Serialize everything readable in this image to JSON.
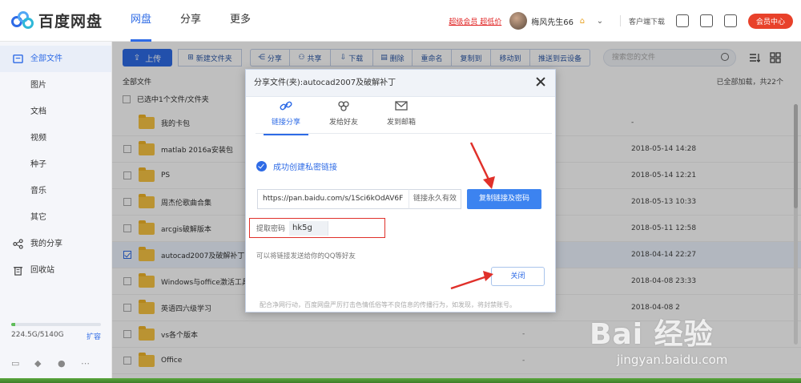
{
  "header": {
    "logo_text": "百度网盘",
    "nav": [
      "网盘",
      "分享",
      "更多"
    ],
    "vip_links": "超级会员 超低价",
    "username": "梅风先生66",
    "client_download": "客户端下载",
    "vip_center": "会员中心"
  },
  "sidebar": {
    "items": [
      {
        "label": "全部文件",
        "icon": "folder-icon"
      },
      {
        "label": "图片"
      },
      {
        "label": "文档"
      },
      {
        "label": "视频"
      },
      {
        "label": "种子"
      },
      {
        "label": "音乐"
      },
      {
        "label": "其它"
      },
      {
        "label": "我的分享",
        "icon": "share-icon"
      },
      {
        "label": "回收站",
        "icon": "trash-icon"
      }
    ],
    "storage_text": "224.5G/5140G",
    "storage_used_fraction": 0.044,
    "expand": "扩容"
  },
  "toolbar": {
    "upload": "上传",
    "new_folder": "新建文件夹",
    "share": "分享",
    "co_share": "共享",
    "download": "下载",
    "delete": "删除",
    "rename": "重命名",
    "copy_to": "复制到",
    "move_to": "移动到",
    "push_device": "推送到云设备",
    "search_placeholder": "搜索您的文件"
  },
  "list": {
    "breadcrumb": "全部文件",
    "loaded_text": "已全部加载，共22个",
    "selected_text": "已选中1个文件/文件夹",
    "rows": [
      {
        "name": "我的卡包",
        "size": "",
        "date": "-"
      },
      {
        "name": "matlab 2016a安装包",
        "size": "",
        "date": "2018-05-14 14:28"
      },
      {
        "name": "PS",
        "size": "",
        "date": "2018-05-14 12:21"
      },
      {
        "name": "周杰伦歌曲合集",
        "size": "",
        "date": "2018-05-13 10:33"
      },
      {
        "name": "arcgis破解版本",
        "size": "",
        "date": "2018-05-11 12:58"
      },
      {
        "name": "autocad2007及破解补丁",
        "size": "",
        "date": "2018-04-14 22:27"
      },
      {
        "name": "Windows与office激活工具",
        "size": "",
        "date": "2018-04-08 23:33"
      },
      {
        "name": "英语四六级学习",
        "size": "",
        "date": "2018-04-08 2"
      },
      {
        "name": "vs各个版本",
        "size": "-",
        "date": ""
      },
      {
        "name": "Office",
        "size": "-",
        "date": ""
      }
    ]
  },
  "modal": {
    "title": "分享文件(夹):autocad2007及破解补丁",
    "tabs": [
      "链接分享",
      "发给好友",
      "发到邮箱"
    ],
    "success_text": "成功创建私密链接",
    "link_url": "https://pan.baidu.com/s/1Sci6kOdAV6F",
    "link_permanent": "链接永久有效",
    "copy_button": "复制链接及密码",
    "pwd_label": "提取密码",
    "pwd_value": "hk5g",
    "hint": "可以将链接发送给你的QQ等好友",
    "close_button": "关闭",
    "notice": "配合净网行动，百度网盘严厉打击色情低俗等不良信息的传播行为，如发现，将封禁账号。"
  },
  "watermark": {
    "brand": "Bai 经验",
    "url": "jingyan.baidu.com"
  },
  "colors": {
    "accent": "#2e6be6",
    "vip": "#e8412a",
    "annotation": "#e0302a"
  }
}
